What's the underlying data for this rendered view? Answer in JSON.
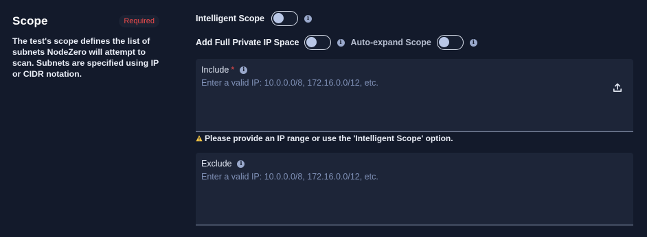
{
  "scope": {
    "title": "Scope",
    "required_badge": "Required",
    "description": "The test's scope defines the list of subnets NodeZero will attempt to scan. Subnets are specified using IP or CIDR notation."
  },
  "options": {
    "intelligent_scope_label": "Intelligent Scope",
    "intelligent_scope_on": false,
    "full_private_ip_label": "Add Full Private IP Space",
    "full_private_ip_on": false,
    "auto_expand_label": "Auto-expand Scope",
    "auto_expand_on": false
  },
  "include": {
    "label": "Include",
    "required_marker": "*",
    "placeholder": "Enter a valid IP: 10.0.0.0/8, 172.16.0.0/12, etc."
  },
  "warning": {
    "text": "Please provide an IP range or use the 'Intelligent Scope' option."
  },
  "exclude": {
    "label": "Exclude",
    "placeholder": "Enter a valid IP: 10.0.0.0/8, 172.16.0.0/12, etc."
  },
  "icons": {
    "info": "info-icon",
    "upload": "upload-icon",
    "warning": "warning-icon"
  },
  "colors": {
    "background": "#131a2b",
    "field_background": "#1d2538",
    "required": "#f04b4b",
    "warning": "#f5c542",
    "placeholder": "#7f90b6"
  }
}
